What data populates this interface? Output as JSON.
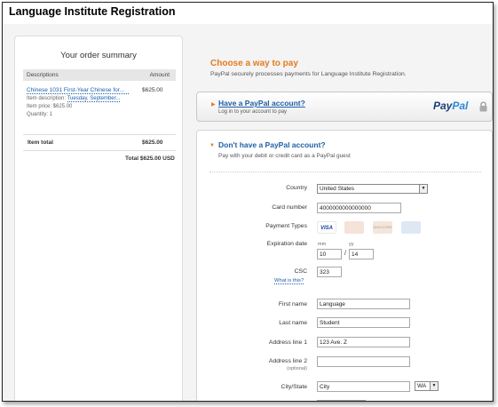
{
  "page": {
    "title": "Language Institute Registration"
  },
  "summary": {
    "heading": "Your order summary",
    "col_desc": "Descriptions",
    "col_amount": "Amount",
    "item": {
      "name": "Chinese 1031 First-Year Chinese for...",
      "amount": "$625.00",
      "desc_label": "Item description:",
      "desc_value": "Tuesday, September...",
      "price": "Item price: $625.00",
      "quantity": "Quantity: 1"
    },
    "item_total_label": "Item total",
    "item_total_value": "$625.00",
    "total": "Total $625.00 USD"
  },
  "choose": {
    "title": "Choose a way to pay",
    "subtitle": "PayPal securely processes payments for Language Institute Registration."
  },
  "paypal_account": {
    "link": "Have a PayPal account?",
    "sub": "Log in to your account to pay",
    "logo_pay": "Pay",
    "logo_pal": "Pal"
  },
  "guest": {
    "title": "Don't have a PayPal account?",
    "sub": "Pay with your debit or credit card as a PayPal guest"
  },
  "form": {
    "country_label": "Country",
    "country_value": "United States",
    "card_label": "Card number",
    "card_value": "4000000000000000",
    "types_label": "Payment Types",
    "cards": {
      "visa": "VISA",
      "mc": "",
      "dc": "DISCOVER",
      "ax": ""
    },
    "exp_label": "Expiration date",
    "mm_label": "mm",
    "yy_label": "yy",
    "mm_value": "10",
    "yy_value": "14",
    "slash": "/",
    "csc_label": "CSC",
    "csc_value": "323",
    "csc_help": "What is this?",
    "first_label": "First name",
    "first_value": "Language",
    "last_label": "Last name",
    "last_value": "Student",
    "addr1_label": "Address line 1",
    "addr1_value": "123 Ave. Z",
    "addr2_label": "Address line 2",
    "addr2_opt": "(optional)",
    "addr2_value": "",
    "city_label": "City/State",
    "city_value": "City",
    "state_value": "WA"
  }
}
